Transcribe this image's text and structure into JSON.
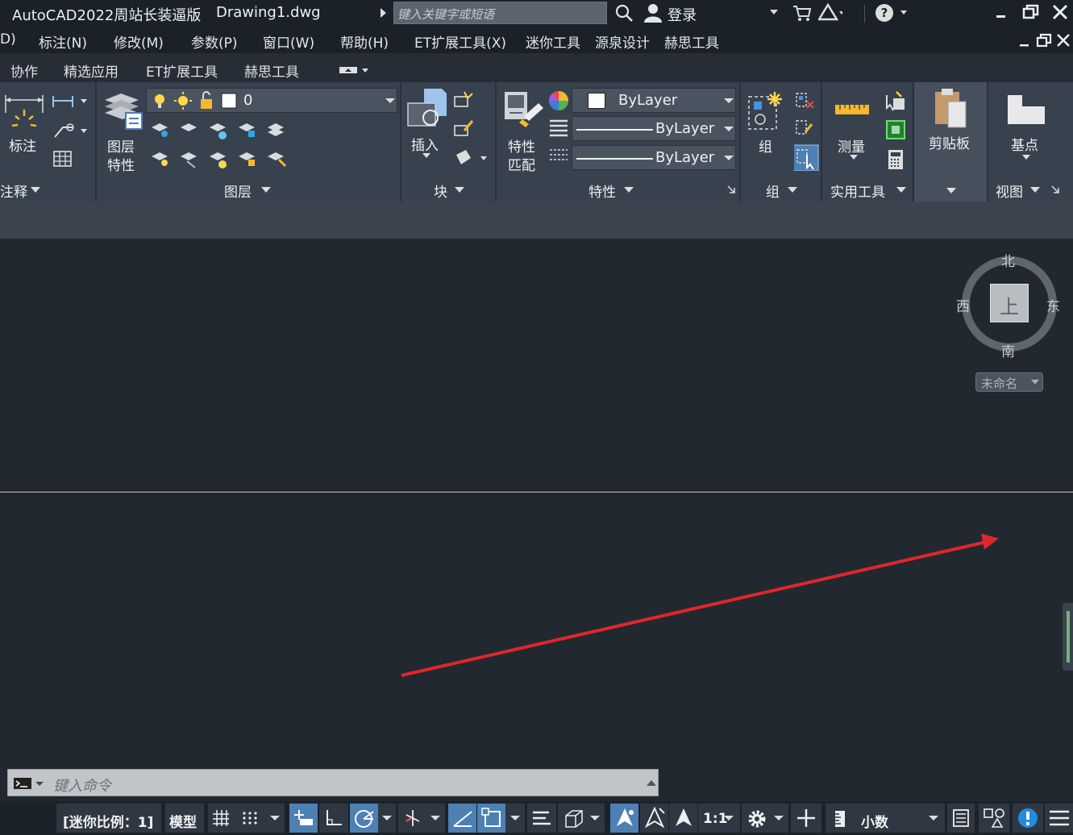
{
  "title": {
    "app_name": "AutoCAD2022周站长装逼版",
    "document": "Drawing1.dwg",
    "search_placeholder": "键入关键字或短语",
    "login": "登录"
  },
  "menu": [
    "D)",
    "标注(N)",
    "修改(M)",
    "参数(P)",
    "窗口(W)",
    "帮助(H)",
    "ET扩展工具(X)",
    "迷你工具",
    "源泉设计",
    "赫思工具"
  ],
  "tabs": [
    "协作",
    "精选应用",
    "ET扩展工具",
    "赫思工具"
  ],
  "ribbon": {
    "annotation": {
      "label": "标注",
      "footer": "注释"
    },
    "layers": {
      "btn_line1": "图层",
      "btn_line2": "特性",
      "current_layer": "0",
      "footer": "图层"
    },
    "block": {
      "insert": "插入",
      "footer": "块"
    },
    "properties": {
      "match_line1": "特性",
      "match_line2": "匹配",
      "color": "ByLayer",
      "linetype": "ByLayer",
      "lineweight": "ByLayer",
      "footer": "特性"
    },
    "groups": {
      "label": "组",
      "footer": "组"
    },
    "utilities": {
      "measure": "测量",
      "footer": "实用工具"
    },
    "clipboard": {
      "label": "剪贴板"
    },
    "view": {
      "base": "基点",
      "footer": "视图"
    }
  },
  "viewcube": {
    "north": "北",
    "south": "南",
    "east": "东",
    "west": "西",
    "face": "上",
    "ucs": "未命名"
  },
  "command": {
    "placeholder": "键入命令"
  },
  "statusbar": {
    "mini_scale": "[迷你比例：1]",
    "model": "模型",
    "scale": "1:1",
    "units": "小数"
  },
  "colors": {
    "accent": "#4d80b3",
    "arrow": "#e0262b",
    "background": "#212830"
  }
}
